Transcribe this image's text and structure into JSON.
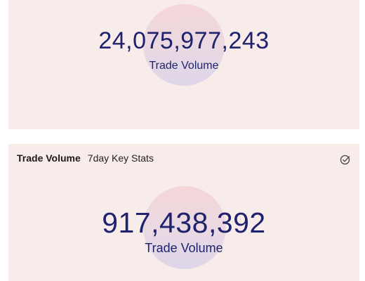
{
  "cards": [
    {
      "value": "24,075,977,243",
      "label": "Trade Volume"
    },
    {
      "header": {
        "title": "Trade Volume",
        "subtitle": "7day Key Stats"
      },
      "value": "917,438,392",
      "label": "Trade Volume",
      "icon": "circle-check-icon"
    }
  ],
  "colors": {
    "card_background": "#f8ecea",
    "metric_text": "#1f236e",
    "circle_top": "#f4d6d8",
    "circle_bottom": "#ddd6e8"
  }
}
